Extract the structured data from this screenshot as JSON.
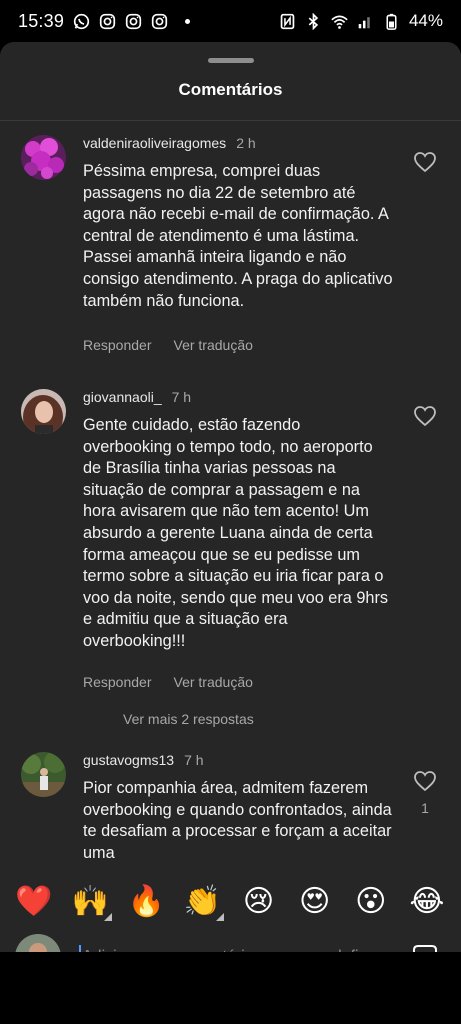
{
  "status": {
    "time": "15:39",
    "battery": "44%"
  },
  "sheet": {
    "title": "Comentários"
  },
  "comments": [
    {
      "username": "valdeniraoliveiragomes",
      "time": "2 h",
      "text": "Péssima empresa, comprei duas passagens no dia 22 de setembro até agora não recebi e-mail de confirmação. A central de atendimento é uma lástima. Passei amanhã inteira ligando e não consigo atendimento. A praga do aplicativo também não funciona.",
      "reply": "Responder",
      "translate": "Ver tradução"
    },
    {
      "username": "giovannaoli_",
      "time": "7 h",
      "text": "Gente cuidado, estão fazendo overbooking o tempo todo, no aeroporto de Brasília tinha varias pessoas na situação de comprar a passagem e na hora avisarem que não tem acento! Um absurdo a gerente Luana ainda de certa forma ameaçou que se eu pedisse um termo sobre a situação eu iria ficar para o voo da noite, sendo que meu voo era 9hrs e admitiu que a situação era overbooking!!!",
      "reply": "Responder",
      "translate": "Ver tradução",
      "more_replies": "Ver mais 2 respostas"
    },
    {
      "username": "gustavogms13",
      "time": "7 h",
      "text": "Pior companhia área, admitem fazerem overbooking e quando confrontados, ainda te desafiam a processar e forçam a aceitar uma",
      "likes": "1"
    }
  ],
  "reactions": [
    "❤️",
    "🙌",
    "🔥",
    "👏",
    "😢",
    "😍",
    "😮",
    "😂"
  ],
  "composer": {
    "placeholder": "Adicione um comentário para voegolofi"
  }
}
